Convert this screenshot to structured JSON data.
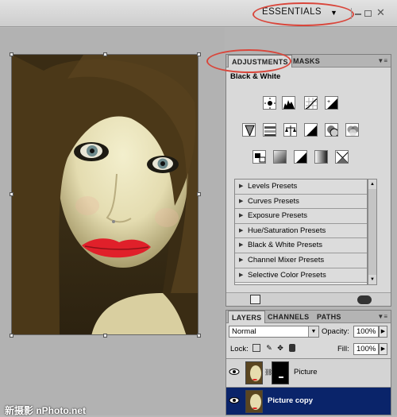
{
  "workspace": {
    "label": "ESSENTIALS",
    "arrow": "▼"
  },
  "window_controls": {
    "close": "✕"
  },
  "adjustments": {
    "tabs": [
      "ADJUSTMENTS",
      "MASKS"
    ],
    "title": "Black & White",
    "presets": [
      "Levels Presets",
      "Curves Presets",
      "Exposure Presets",
      "Hue/Saturation Presets",
      "Black & White Presets",
      "Channel Mixer Presets",
      "Selective Color Presets"
    ],
    "icons_row1": [
      "brightness-contrast-icon",
      "levels-icon",
      "curves-icon",
      "exposure-icon"
    ],
    "icons_row2": [
      "vibrance-icon",
      "hue-saturation-icon",
      "color-balance-icon",
      "black-white-icon",
      "photo-filter-icon",
      "channel-mixer-icon"
    ],
    "icons_row3": [
      "invert-icon",
      "posterize-icon",
      "threshold-icon",
      "gradient-map-icon",
      "selective-color-icon"
    ]
  },
  "layers": {
    "tabs": [
      "LAYERS",
      "CHANNELS",
      "PATHS"
    ],
    "blend_mode": "Normal",
    "opacity_label": "Opacity:",
    "opacity_value": "100%",
    "lock_label": "Lock:",
    "fill_label": "Fill:",
    "fill_value": "100%",
    "items": [
      {
        "name": "Picture",
        "selected": false
      },
      {
        "name": "Picture copy",
        "selected": true
      }
    ]
  },
  "watermark": "新摄影 nPhoto.net",
  "colors": {
    "highlight": "#d9463b",
    "selected_layer": "#0a246a",
    "panel": "#d9d9d9"
  }
}
